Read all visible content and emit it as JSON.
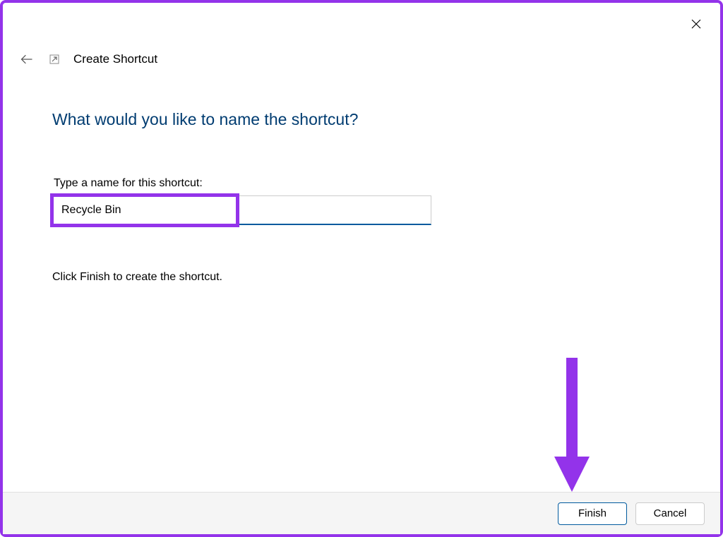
{
  "header": {
    "title": "Create Shortcut"
  },
  "content": {
    "heading": "What would you like to name the shortcut?",
    "input_label": "Type a name for this shortcut:",
    "input_value": "Recycle Bin",
    "instruction": "Click Finish to create the shortcut."
  },
  "footer": {
    "finish_label": "Finish",
    "cancel_label": "Cancel"
  },
  "colors": {
    "highlight": "#9333ea",
    "accent": "#005a9e"
  }
}
